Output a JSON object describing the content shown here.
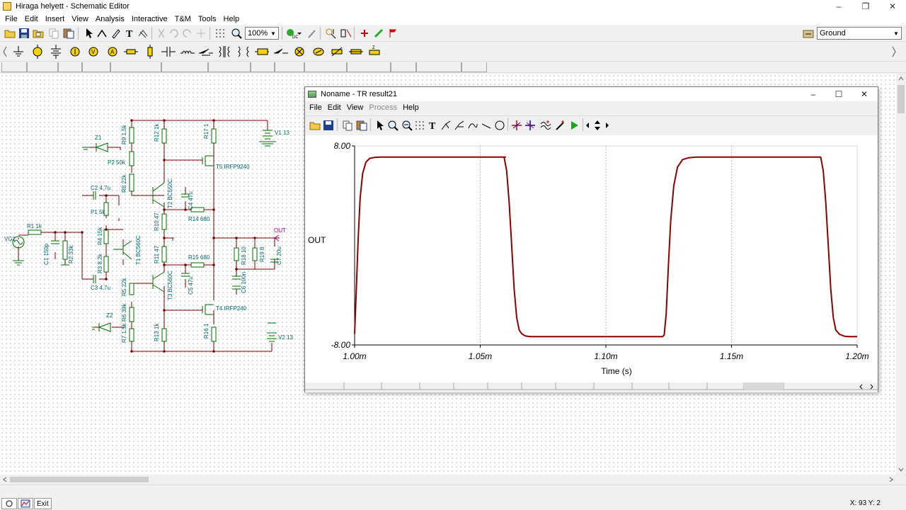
{
  "window": {
    "title": "Hiraga helyett - Schematic Editor",
    "minimize": "–",
    "maximize": "❐",
    "close": "✕"
  },
  "menu": [
    "File",
    "Edit",
    "Insert",
    "View",
    "Analysis",
    "Interactive",
    "T&M",
    "Tools",
    "Help"
  ],
  "toolbar": {
    "zoom": "100%",
    "layer": "Ground"
  },
  "schematic": {
    "labels": {
      "r9": "R9 1,5k",
      "r12": "R12 1k",
      "r17": "R17 1",
      "v1": "V1 13",
      "z1": "Z1",
      "p2": "P2 50k",
      "t5": "T5 IRFP9240",
      "r8": "R8 22k",
      "c2": "C2 4,7u",
      "t2": "T2 BC550C",
      "c4": "C4 47u",
      "p1": "P1 5k",
      "r10": "R10 47",
      "r14": "R14 680",
      "r1": "R1 1k",
      "r4": "R4 15k",
      "t1": "T1 BC560C",
      "out": "OUT",
      "vg1": "VG1",
      "c1": "C1 150p",
      "r2": "R2 33k",
      "r11": "R11 47",
      "r15": "R15 680",
      "r18": "R18 10",
      "r19": "R19 8",
      "c7": "C7 20u",
      "r3": "R3 8,2k",
      "c3": "C3 4,7u",
      "r5": "R5 22k",
      "t3": "T3 BC560C",
      "c5": "C5 47u",
      "c6": "C6 100n",
      "z2": "Z2",
      "r6": "R6 39k",
      "t4": "T4 IRFP240",
      "r7": "R7 1,5k",
      "r13": "R13 1k",
      "r16": "R16 1",
      "v2": "V2 13"
    }
  },
  "result_window": {
    "title": "Noname - TR result21",
    "menu": {
      "file": "File",
      "edit": "Edit",
      "view": "View",
      "process": "Process",
      "help": "Help"
    }
  },
  "chart_data": {
    "type": "line",
    "title": "",
    "xlabel": "Time (s)",
    "ylabel": "OUT",
    "xlim": [
      0.001,
      0.0012
    ],
    "ylim": [
      -8,
      8
    ],
    "x_tick_labels": [
      "1.00m",
      "1.05m",
      "1.10m",
      "1.15m",
      "1.20m"
    ],
    "x_ticks": [
      0.001,
      0.00105,
      0.0011,
      0.00115,
      0.0012
    ],
    "y_tick_labels": [
      "8.00",
      "-8.00"
    ],
    "y_ticks": [
      8,
      -8
    ],
    "grid": true,
    "line_color": "#8b0000",
    "series": [
      {
        "x": [
          0.001,
          0.0010006,
          0.0010014,
          0.0010022,
          0.0010032,
          0.0010045,
          0.001006,
          0.001008,
          0.00101,
          0.00102,
          0.00104,
          0.00106,
          0.0010595,
          0.0010605,
          0.0010615,
          0.0010625,
          0.0010635,
          0.0010645,
          0.0010655,
          0.0010665,
          0.001068,
          0.00107,
          0.001072,
          0.00108,
          0.0011,
          0.00112,
          0.0011226,
          0.0011232,
          0.001124,
          0.0011248,
          0.0011258,
          0.001127,
          0.0011285,
          0.0011305,
          0.001133,
          0.001136,
          0.00114,
          0.00116,
          0.00118,
          0.0011855,
          0.0011865,
          0.0011875,
          0.0011885,
          0.0011895,
          0.0011905,
          0.0011915,
          0.001193,
          0.001195,
          0.001197,
          0.0012
        ],
        "y": [
          -7.1,
          -4.0,
          0.5,
          3.8,
          5.8,
          6.7,
          7.0,
          7.08,
          7.1,
          7.1,
          7.1,
          7.1,
          7.1,
          6.0,
          3.5,
          0.0,
          -3.5,
          -5.8,
          -6.8,
          -7.1,
          -7.28,
          -7.33,
          -7.33,
          -7.33,
          -7.33,
          -7.33,
          -7.33,
          -7.2,
          -5.5,
          -2.0,
          2.0,
          4.8,
          6.3,
          6.9,
          7.05,
          7.1,
          7.1,
          7.1,
          7.1,
          7.1,
          6.0,
          3.5,
          0.0,
          -3.5,
          -5.8,
          -6.8,
          -7.15,
          -7.3,
          -7.33,
          -7.33
        ]
      }
    ]
  }
}
